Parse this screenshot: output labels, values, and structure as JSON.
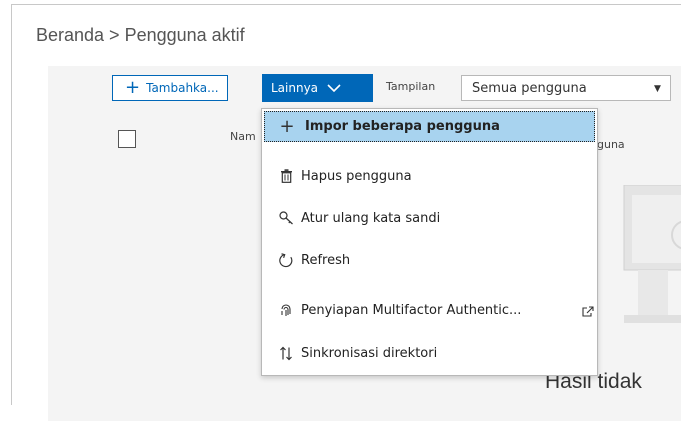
{
  "breadcrumb": "Beranda > Pengguna aktif",
  "toolbar": {
    "add_label": "Tambahka...",
    "more_label": "Lainnya",
    "view_label": "Tampilan",
    "view_selected": "Semua pengguna"
  },
  "table": {
    "col_name": "Nam",
    "col_username_partial": "guna"
  },
  "empty_state": "Hasil tidak",
  "menu": {
    "items": [
      {
        "label": "Impor beberapa pengguna",
        "icon": "plus-icon"
      },
      {
        "label": "Hapus pengguna",
        "icon": "trash-icon"
      },
      {
        "label": "Atur ulang kata sandi",
        "icon": "key-icon"
      },
      {
        "label": "Refresh",
        "icon": "refresh-icon"
      },
      {
        "label": "Penyiapan Multifactor Authentic...",
        "icon": "fingerprint-icon"
      },
      {
        "label": "Sinkronisasi direktori",
        "icon": "sync-arrows-icon"
      }
    ]
  },
  "colors": {
    "accent": "#0067b8",
    "highlight": "#a8d3ef"
  }
}
